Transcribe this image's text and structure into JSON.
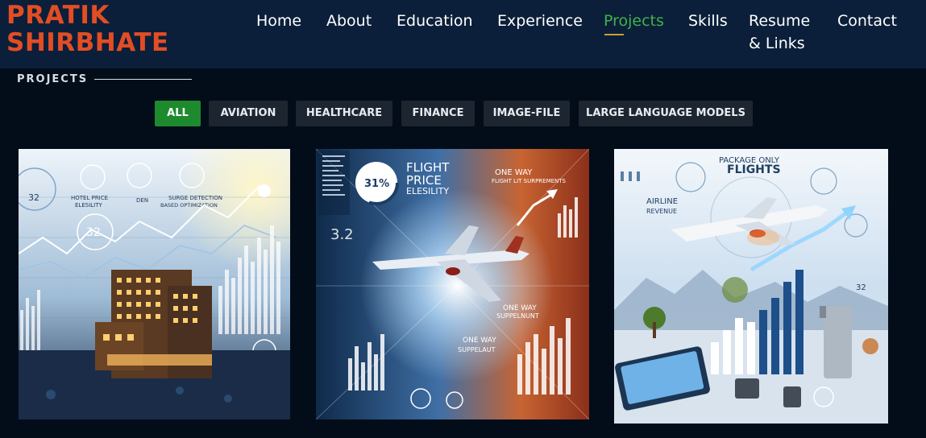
{
  "brand": {
    "line1": "PRATIK",
    "line2": "SHIRBHATE",
    "color": "#e34d24"
  },
  "nav": {
    "items": [
      {
        "label": "Home"
      },
      {
        "label": "About"
      },
      {
        "label": "Education"
      },
      {
        "label": "Experience"
      },
      {
        "label": "Projects",
        "active": true
      },
      {
        "label": "Skills"
      },
      {
        "label": "Resume"
      },
      {
        "label": "& Links"
      },
      {
        "label": "Contact"
      }
    ],
    "active_color": "#3fb24a"
  },
  "section": {
    "title": "PROJECTS"
  },
  "filters": [
    {
      "label": "ALL",
      "active": true
    },
    {
      "label": "AVIATION"
    },
    {
      "label": "HEALTHCARE"
    },
    {
      "label": "FINANCE"
    },
    {
      "label": "IMAGE-FILE"
    },
    {
      "label": "LARGE LANGUAGE MODELS"
    }
  ],
  "projects": [
    {
      "image": "hotel-analytics-illustration",
      "texts": {
        "t1": "HOTEL PRICE",
        "t2": "ELESILITY",
        "t3": "SURGE DETECTION",
        "t4": "BASED OPTIMIZATION",
        "t5": "DEN",
        "t6": "32",
        "t7": "32"
      }
    },
    {
      "image": "flight-price-illustration",
      "texts": {
        "t1": "FLIGHT",
        "t2": "PRICE",
        "t3": "ELESILITY",
        "t4": "31%",
        "t5": "ONE WAY",
        "t6": "FLIGHT LIT SURPREMENTS",
        "t7": "3.2",
        "t8": "ONE WAY",
        "t9": "SUPPELNUNT",
        "t10": "ONE WAY",
        "t11": "SUPPELAUT"
      }
    },
    {
      "image": "package-flights-illustration",
      "texts": {
        "t1": "PACKAGE ONLY",
        "t2": "FLIGHTS",
        "t3": "AIRLINE",
        "t4": "REVENUE",
        "t5": "32"
      }
    }
  ]
}
